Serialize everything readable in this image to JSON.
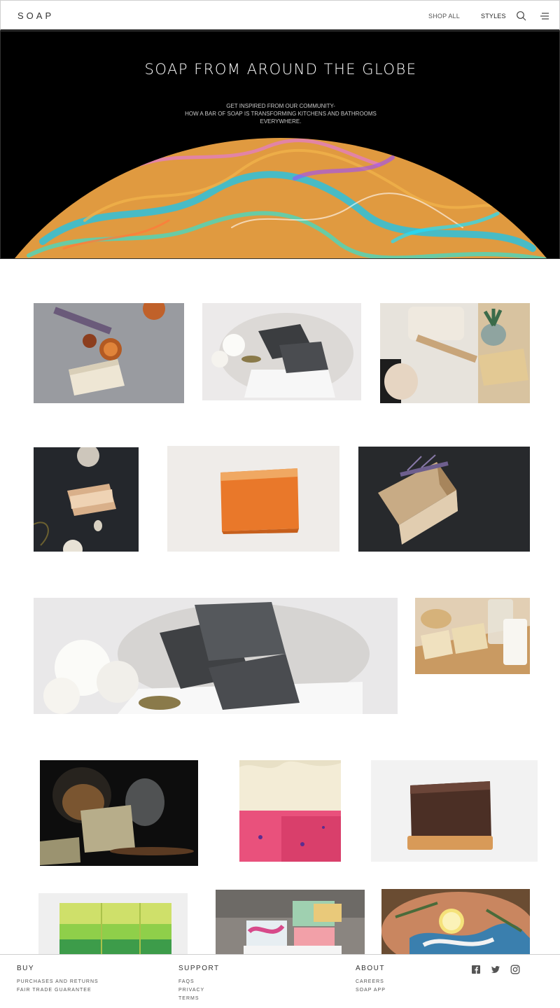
{
  "header": {
    "logo": "SOAP",
    "nav": [
      "SHOP ALL",
      "STYLES"
    ],
    "icons": [
      "search-icon",
      "menu-icon"
    ]
  },
  "hero": {
    "title": "SOAP FROM AROUND THE GLOBE",
    "subtitle": [
      "GET INSPIRED FROM OUR COMMUNITY-",
      "HOW A BAR OF SOAP IS TRANSFORMING KITCHENS AND BATHROOMS",
      "EVERYWHERE."
    ]
  },
  "gallery": {
    "images": [
      "lavender-citrus-soap-photo",
      "charcoal-soap-dish-photo",
      "bath-set-soap-photo",
      "wrapped-soaps-dark-photo",
      "orange-soap-bar-photo",
      "lavender-oat-soap-photo",
      "charcoal-soap-closeup-photo",
      "soy-milk-soap-photo",
      "herbal-soap-jar-photo",
      "pink-layer-soap-photo",
      "coffee-soap-bar-photo",
      "green-layer-soap-photo",
      "swirl-soap-stack-photo",
      "lemon-soap-platter-photo"
    ]
  },
  "footer": {
    "buy": {
      "heading": "BUY",
      "links": [
        "PURCHASES AND RETURNS",
        "FAIR TRADE GUARANTEE"
      ]
    },
    "support": {
      "heading": "SUPPORT",
      "links": [
        "FAQS",
        "PRIVACY",
        "TERMS"
      ]
    },
    "about": {
      "heading": "ABOUT",
      "links": [
        "CAREERS",
        "SOAP APP"
      ]
    },
    "social": [
      "facebook-icon",
      "twitter-icon",
      "instagram-icon"
    ]
  }
}
